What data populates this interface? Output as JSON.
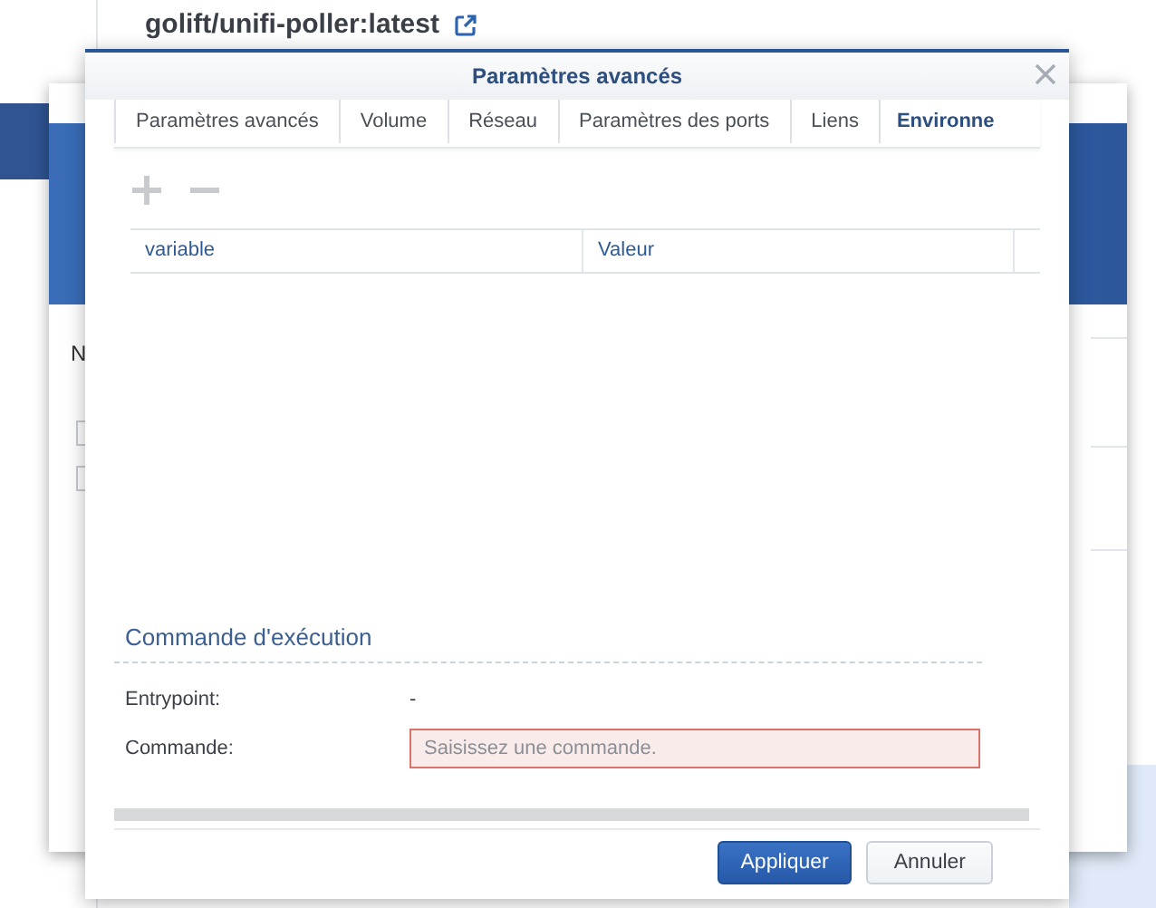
{
  "background_page": {
    "image_title": "golift/unifi-poller:latest"
  },
  "background_dialog": {
    "label": "N",
    "checkboxes": [
      {
        "checked": false
      },
      {
        "checked": false
      }
    ]
  },
  "dialog": {
    "title": "Paramètres avancés",
    "tabs": [
      {
        "label": "Paramètres avancés",
        "selected": false
      },
      {
        "label": "Volume",
        "selected": false
      },
      {
        "label": "Réseau",
        "selected": false
      },
      {
        "label": "Paramètres des ports",
        "selected": false
      },
      {
        "label": "Liens",
        "selected": false
      },
      {
        "label": "Environne",
        "selected": true
      }
    ],
    "toolbar": {
      "add_disabled": true,
      "remove_disabled": true
    },
    "table": {
      "columns": [
        "variable",
        "Valeur"
      ]
    },
    "section_title": "Commande d'exécution",
    "fields": [
      {
        "label": "Entrypoint:",
        "kind": "text",
        "value": "-"
      },
      {
        "label": "Commande:",
        "kind": "input",
        "placeholder": "Saisissez une commande.",
        "invalid": true
      }
    ],
    "buttons": [
      {
        "label": "Appliquer",
        "primary": true
      },
      {
        "label": "Annuler",
        "primary": false
      }
    ]
  }
}
